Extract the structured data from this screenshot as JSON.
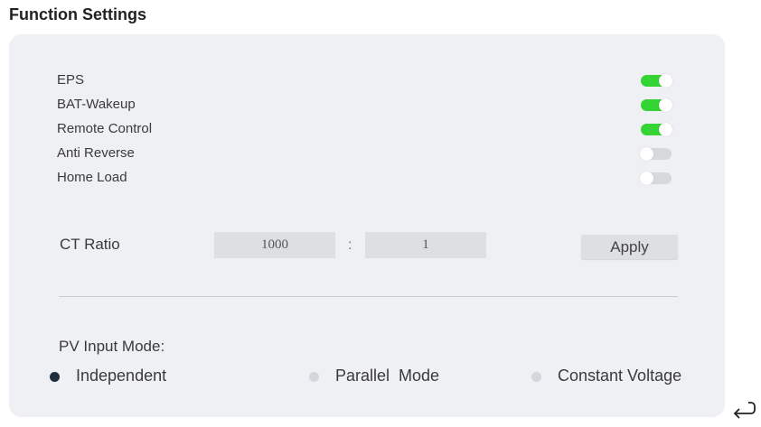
{
  "page": {
    "title": "Function Settings"
  },
  "toggles": [
    {
      "label": "EPS",
      "on": true
    },
    {
      "label": "BAT-Wakeup",
      "on": true
    },
    {
      "label": "Remote Control",
      "on": true
    },
    {
      "label": "Anti Reverse",
      "on": false
    },
    {
      "label": "Home Load",
      "on": false
    }
  ],
  "ct_ratio": {
    "label": "CT Ratio",
    "primary": "1000",
    "separator": ":",
    "secondary": "1",
    "apply_label": "Apply"
  },
  "pv_input_mode": {
    "label": "PV Input Mode:",
    "options": [
      {
        "label": "Independent",
        "selected": true
      },
      {
        "label": "Parallel  Mode",
        "selected": false
      },
      {
        "label": "Constant Voltage",
        "selected": false
      }
    ]
  },
  "colors": {
    "switch_on": "#33d433",
    "switch_off": "#d6d8dc",
    "radio_selected": "#1f2d3d",
    "panel_bg": "#eef0f3"
  },
  "icons": {
    "return": "return-arrow-icon"
  }
}
